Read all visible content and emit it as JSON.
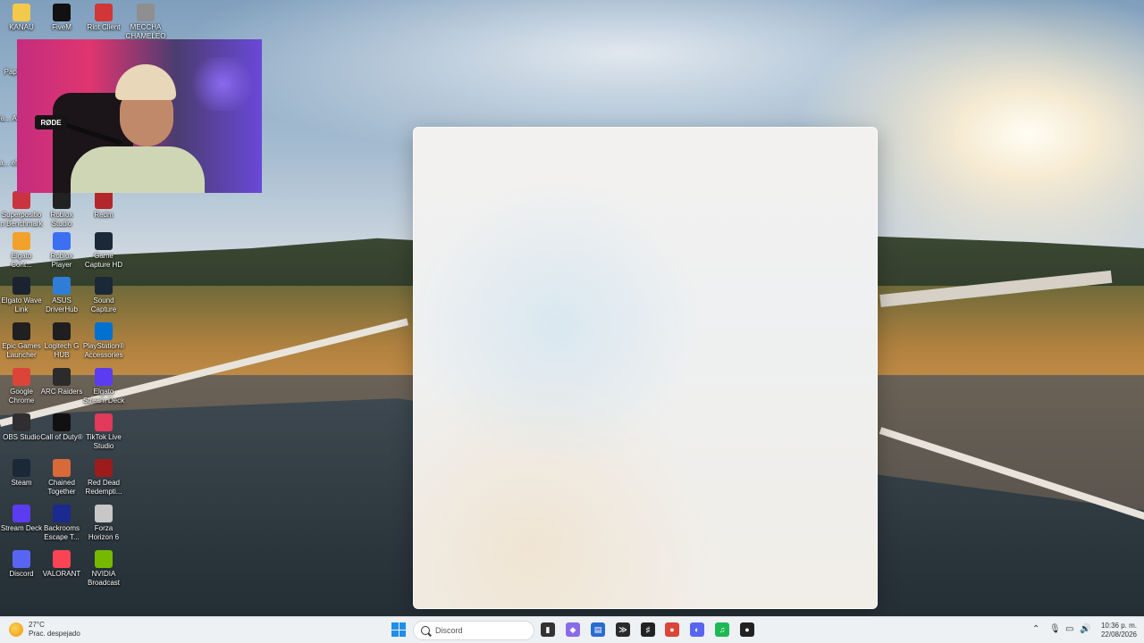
{
  "desktop": {
    "icons": [
      {
        "label": "KANAU",
        "icon": "folder-icon",
        "color": "#f3c94b"
      },
      {
        "label": "FiveM",
        "icon": "fivem-icon",
        "color": "#111111"
      },
      {
        "label": "Riot Client",
        "icon": "riot-client-icon",
        "color": "#d13639"
      },
      {
        "label": "MECCHA CHAMELEON",
        "icon": "meccha-chameleon-icon",
        "color": "#8f8f8f"
      },
      {
        "label": "Superposition Benchmark",
        "icon": "superposition-icon",
        "color": "#c9343f"
      },
      {
        "label": "Roblox Studio",
        "icon": "roblox-studio-icon",
        "color": "#222222"
      },
      {
        "label": "Redm",
        "icon": "redm-icon",
        "color": "#b3262b"
      },
      {
        "label": "Elgato Cont...",
        "icon": "elgato-control-center-icon",
        "color": "#f2a22a"
      },
      {
        "label": "Roblox Player",
        "icon": "roblox-player-icon",
        "color": "#3d6ff2"
      },
      {
        "label": "Game Capture HD",
        "icon": "game-capture-icon",
        "color": "#1b2838"
      },
      {
        "label": "Elgato Wave Link",
        "icon": "wave-link-icon",
        "color": "#1c2330"
      },
      {
        "label": "ASUS DriverHub",
        "icon": "asus-driverhub-icon",
        "color": "#2f7dd6"
      },
      {
        "label": "Sound Capture",
        "icon": "sound-capture-icon",
        "color": "#1b2838"
      },
      {
        "label": "Epic Games Launcher",
        "icon": "epic-games-icon",
        "color": "#202020"
      },
      {
        "label": "Logitech G HUB",
        "icon": "logitech-ghub-icon",
        "color": "#1f1f1f"
      },
      {
        "label": "PlayStation® Accessories",
        "icon": "playstation-accessories-icon",
        "color": "#0070d1"
      },
      {
        "label": "Google Chrome",
        "icon": "chrome-icon",
        "color": "#db4437"
      },
      {
        "label": "ARC Raiders",
        "icon": "arc-raiders-icon",
        "color": "#2b2b2b"
      },
      {
        "label": "Elgato Stream Deck",
        "icon": "stream-deck-icon",
        "color": "#5b3cf0"
      },
      {
        "label": "OBS Studio",
        "icon": "obs-icon",
        "color": "#302e31"
      },
      {
        "label": "Call of Duty®",
        "icon": "call-of-duty-icon",
        "color": "#111111"
      },
      {
        "label": "TikTok Live Studio",
        "icon": "tiktok-live-icon",
        "color": "#e13a5a"
      },
      {
        "label": "Steam",
        "icon": "steam-icon",
        "color": "#1b2838"
      },
      {
        "label": "Chained Together",
        "icon": "chained-together-icon",
        "color": "#d86a3a"
      },
      {
        "label": "Red Dead Redempti...",
        "icon": "red-dead-icon",
        "color": "#9c1c1c"
      },
      {
        "label": "Stream Deck",
        "icon": "stream-deck-2-icon",
        "color": "#5b3cf0"
      },
      {
        "label": "Backrooms Escape T...",
        "icon": "backrooms-icon",
        "color": "#1a2a8f"
      },
      {
        "label": "Forza Horizon 6",
        "icon": "forza-icon",
        "color": "#c7c7c7"
      },
      {
        "label": "Discord",
        "icon": "discord-icon",
        "color": "#5865f2"
      },
      {
        "label": "VALORANT",
        "icon": "valorant-icon",
        "color": "#fa4454"
      },
      {
        "label": "NVIDIA Broadcast",
        "icon": "nvidia-broadcast-icon",
        "color": "#76b900"
      }
    ],
    "partial_icons": [
      {
        "label": "Pape...",
        "icon": "paper-icon"
      },
      {
        "label": "Grea... An...",
        "icon": "grea-icon"
      },
      {
        "label": "Inicia... ele...",
        "icon": "inicia-icon"
      }
    ]
  },
  "webcam": {
    "mic_brand": "RØDE"
  },
  "taskbar": {
    "weather": {
      "temp": "27°C",
      "condition": "Prac. despejado"
    },
    "search": {
      "value": "Discord"
    },
    "apps": [
      {
        "name": "task-view",
        "glyph": "▮",
        "color": "#333333"
      },
      {
        "name": "copilot",
        "glyph": "◆",
        "color": "#8a6be8"
      },
      {
        "name": "file-explorer",
        "glyph": "▤",
        "color": "#2a6bd1"
      },
      {
        "name": "terminal",
        "glyph": "≫",
        "color": "#2b2b2b"
      },
      {
        "name": "audio-app",
        "glyph": "♯",
        "color": "#222222"
      },
      {
        "name": "chrome",
        "glyph": "●",
        "color": "#db4437"
      },
      {
        "name": "discord",
        "glyph": "◐",
        "color": "#5865f2"
      },
      {
        "name": "spotify",
        "glyph": "♫",
        "color": "#1db954"
      },
      {
        "name": "red-app",
        "glyph": "●",
        "color": "#222222"
      }
    ],
    "clock": {
      "time": "10:36 p. m.",
      "date": "22/08/2026"
    }
  }
}
